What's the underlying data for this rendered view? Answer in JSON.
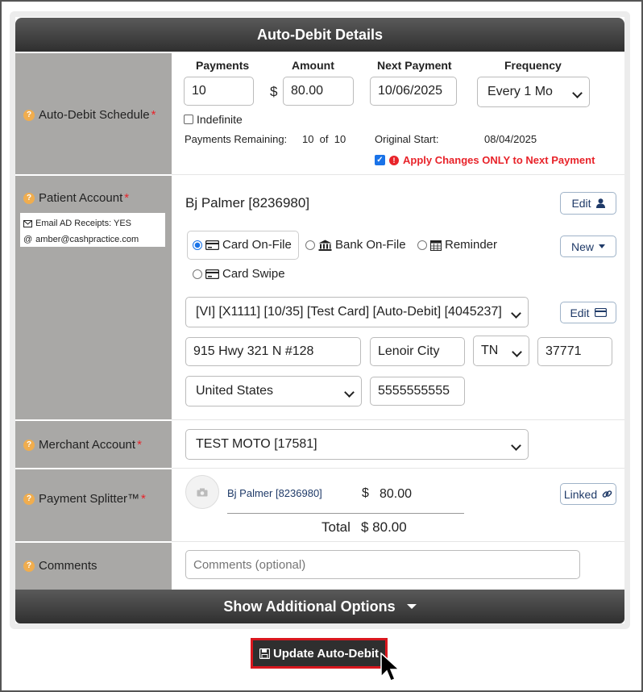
{
  "header": {
    "title": "Auto-Debit Details"
  },
  "schedule": {
    "label": "Auto-Debit Schedule",
    "payments_header": "Payments",
    "amount_header": "Amount",
    "next_payment_header": "Next Payment",
    "frequency_header": "Frequency",
    "payments_value": "10",
    "currency_symbol": "$",
    "amount_value": "80.00",
    "next_payment_value": "10/06/2025",
    "frequency_value": "Every 1 Mo",
    "indefinite_label": "Indefinite",
    "indefinite_checked": false,
    "payments_remaining_label": "Payments Remaining:",
    "payments_remaining_value": "10  of  10",
    "original_start_label": "Original Start:",
    "original_start_value": "08/04/2025",
    "apply_changes_label": "Apply Changes ONLY to Next Payment",
    "apply_changes_checked": true
  },
  "patient": {
    "label": "Patient Account",
    "email_receipts": "Email AD Receipts: YES",
    "email": "amber@cashpractice.com",
    "name": "Bj Palmer [8236980]",
    "edit_label": "Edit",
    "payment_methods": [
      {
        "label": "Card On-File",
        "selected": true
      },
      {
        "label": "Bank On-File",
        "selected": false
      },
      {
        "label": "Reminder",
        "selected": false
      },
      {
        "label": "Card Swipe",
        "selected": false
      }
    ],
    "new_label": "New",
    "card_value": "[VI] [X1111] [10/35] [Test Card] [Auto-Debit] [4045237]",
    "card_edit_label": "Edit",
    "address": "915 Hwy 321 N #128",
    "city": "Lenoir City",
    "state": "TN",
    "zip": "37771",
    "country": "United States",
    "phone": "5555555555"
  },
  "merchant": {
    "label": "Merchant Account",
    "value": "TEST MOTO [17581]"
  },
  "splitter": {
    "label": "Payment Splitter™",
    "patient_link": "Bj Palmer [8236980]",
    "currency_symbol": "$",
    "amount": "80.00",
    "linked_label": "Linked",
    "total_label": "Total",
    "total_value": "$ 80.00"
  },
  "comments": {
    "label": "Comments",
    "placeholder": "Comments (optional)"
  },
  "footer": {
    "additional_options_label": "Show Additional Options"
  },
  "actions": {
    "update_label": "Update Auto-Debit"
  },
  "colors": {
    "header_bg": "#3a3a3a",
    "label_bg": "#a9a8a6",
    "required": "#e8232a",
    "help_icon": "#f0ad4e",
    "link": "#1f3a68",
    "highlight_border": "#d9171e"
  }
}
